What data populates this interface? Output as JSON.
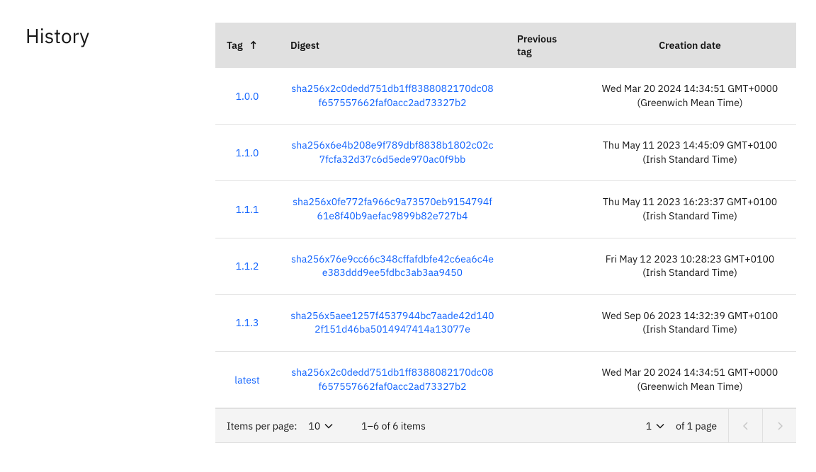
{
  "section_title": "History",
  "columns": {
    "tag": "Tag",
    "digest": "Digest",
    "previous_tag": "Previous tag",
    "creation_date": "Creation date"
  },
  "rows": [
    {
      "tag": "1.0.0",
      "digest": "sha256x2c0dedd751db1ff8388082170dc08f657557662faf0acc2ad73327b2",
      "previous_tag": "",
      "creation_date": "Wed Mar 20 2024 14:34:51 GMT+0000 (Greenwich Mean Time)"
    },
    {
      "tag": "1.1.0",
      "digest": "sha256x6e4b208e9f789dbf8838b1802c02c7fcfa32d37c6d5ede970ac0f9bb",
      "previous_tag": "",
      "creation_date": "Thu May 11 2023 14:45:09 GMT+0100 (Irish Standard Time)"
    },
    {
      "tag": "1.1.1",
      "digest": "sha256x0fe772fa966c9a73570eb9154794f61e8f40b9aefac9899b82e727b4",
      "previous_tag": "",
      "creation_date": "Thu May 11 2023 16:23:37 GMT+0100 (Irish Standard Time)"
    },
    {
      "tag": "1.1.2",
      "digest": "sha256x76e9cc66c348cffafdbfe42c6ea6c4ee383ddd9ee5fdbc3ab3aa9450",
      "previous_tag": "",
      "creation_date": "Fri May 12 2023 10:28:23 GMT+0100 (Irish Standard Time)"
    },
    {
      "tag": "1.1.3",
      "digest": "sha256x5aee1257f4537944bc7aade42d1402f151d46ba5014947414a13077e",
      "previous_tag": "",
      "creation_date": "Wed Sep 06 2023 14:32:39 GMT+0100 (Irish Standard Time)"
    },
    {
      "tag": "latest",
      "digest": "sha256x2c0dedd751db1ff8388082170dc08f657557662faf0acc2ad73327b2",
      "previous_tag": "",
      "creation_date": "Wed Mar 20 2024 14:34:51 GMT+0000 (Greenwich Mean Time)"
    }
  ],
  "pagination": {
    "items_per_page_label": "Items per page:",
    "page_size": "10",
    "range_text": "1–6 of 6 items",
    "current_page": "1",
    "of_pages_text": "of 1 page"
  }
}
